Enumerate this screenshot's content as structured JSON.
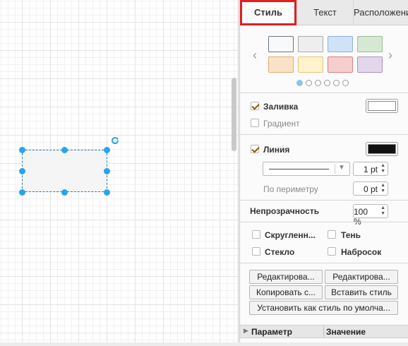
{
  "tabs": [
    "Стиль",
    "Текст",
    "Расположение"
  ],
  "swatch_colors": [
    {
      "fill": "#f8f9fa",
      "border": "#6c757d"
    },
    {
      "fill": "#eeeeee",
      "border": "#a9a9a9"
    },
    {
      "fill": "#d0e2f5",
      "border": "#8fb0d8"
    },
    {
      "fill": "#d6e8d4",
      "border": "#98bf92"
    },
    {
      "fill": "#fbe1c7",
      "border": "#e1ad6e"
    },
    {
      "fill": "#fff2cc",
      "border": "#e1c77a"
    },
    {
      "fill": "#f7cecc",
      "border": "#d6807d"
    },
    {
      "fill": "#e2d6eb",
      "border": "#a994c0"
    }
  ],
  "swatch_page_dots": 6,
  "fill": {
    "label": "Заливка",
    "checked": true,
    "color": "#ffffff"
  },
  "gradient": {
    "label": "Градиент",
    "checked": false
  },
  "line": {
    "label": "Линия",
    "checked": true,
    "color": "#111111",
    "width": "1 pt"
  },
  "perimeter": {
    "label": "По периметру",
    "value": "0 pt"
  },
  "opacity": {
    "label": "Непрозрачность",
    "value": "100 %"
  },
  "options": {
    "rounded": "Скругленн...",
    "shadow": "Тень",
    "glass": "Стекло",
    "sketch": "Набросок"
  },
  "buttons": {
    "edit1": "Редактирова...",
    "edit2": "Редактирова...",
    "copy": "Копировать с...",
    "paste": "Вставить стиль",
    "set_default": "Установить как стиль по умолча..."
  },
  "table": {
    "col1": "Параметр",
    "col2": "Значение"
  }
}
